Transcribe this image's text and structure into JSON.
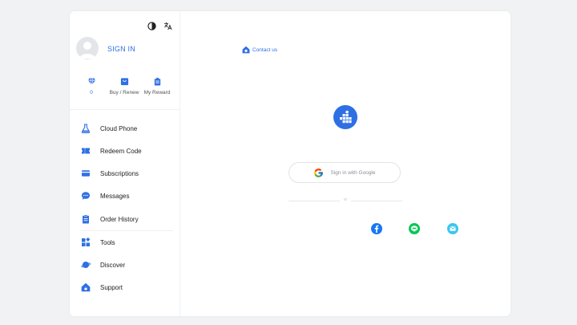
{
  "sidebar": {
    "signin_label": "SIGN IN",
    "stats": [
      {
        "label": "0",
        "icon": "diamond-icon"
      },
      {
        "label": "Buy / Renew",
        "icon": "shop-icon"
      },
      {
        "label": "My Reward",
        "icon": "gift-icon"
      }
    ],
    "menu": [
      {
        "label": "Cloud Phone",
        "icon": "flask-icon"
      },
      {
        "label": "Redeem Code",
        "icon": "ticket-icon"
      },
      {
        "label": "Subscriptions",
        "icon": "card-icon"
      },
      {
        "label": "Messages",
        "icon": "chat-icon"
      },
      {
        "label": "Order History",
        "icon": "clipboard-icon"
      },
      {
        "label": "Tools",
        "icon": "grid-icon"
      },
      {
        "label": "Discover",
        "icon": "planet-icon"
      },
      {
        "label": "Support",
        "icon": "home-support-icon"
      }
    ]
  },
  "main": {
    "contact_label": "Contact us",
    "google_label": "Sign in with Google",
    "or_label": "or"
  },
  "colors": {
    "accent": "#2e6fe4",
    "facebook": "#1877f2",
    "line": "#06c755",
    "email": "#3bc7ee"
  }
}
